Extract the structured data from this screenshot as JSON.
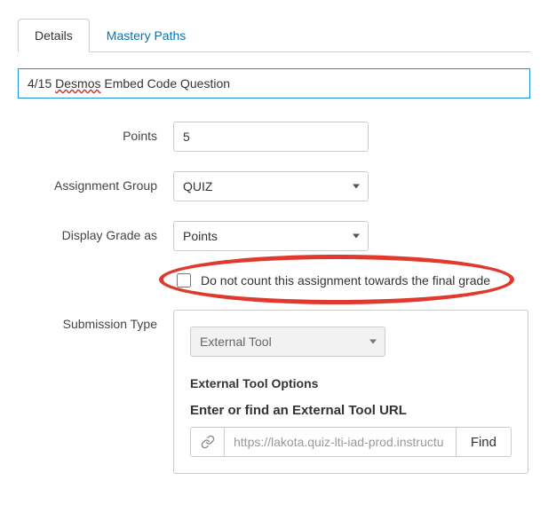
{
  "tabs": {
    "details": "Details",
    "mastery_paths": "Mastery Paths"
  },
  "title": {
    "pre": "4/15 ",
    "spell": "Desmos",
    "post": " Embed Code Question"
  },
  "labels": {
    "points": "Points",
    "assignment_group": "Assignment Group",
    "display_grade_as": "Display Grade as",
    "submission_type": "Submission Type"
  },
  "fields": {
    "points_value": "5",
    "assignment_group_value": "QUIZ",
    "display_grade_value": "Points",
    "do_not_count_label": "Do not count this assignment towards the final grade",
    "submission_type_value": "External Tool"
  },
  "external_tool": {
    "options_title": "External Tool Options",
    "enter_find_title": "Enter or find an External Tool URL",
    "url_value": "https://lakota.quiz-lti-iad-prod.instructu",
    "find_label": "Find"
  }
}
